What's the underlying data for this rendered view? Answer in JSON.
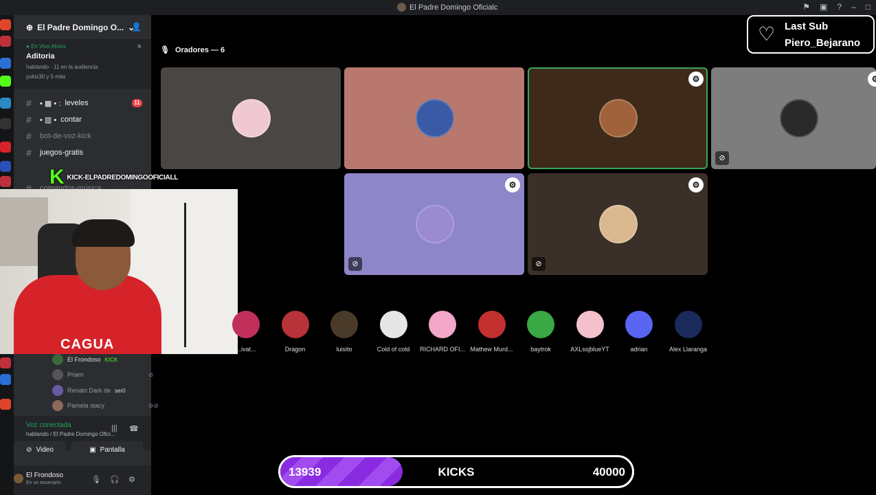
{
  "window": {
    "title": "El Padre Domingo Oficialᴄ"
  },
  "server": {
    "name": "El Padre Domingo O..."
  },
  "live": {
    "status": "En Vivo Ahora",
    "stage_name": "Aditoria",
    "detail": "hablando · 11 en la audiencia",
    "viewers": "yukix30 y 5 más",
    "close": "×"
  },
  "channels": [
    {
      "prefix": "• ▩ • :",
      "name": "leveles",
      "badge": "11"
    },
    {
      "prefix": "• ▥ •",
      "name": "contar"
    },
    {
      "prefix": "",
      "name": "bot-de-voz-kick"
    },
    {
      "prefix": "",
      "name": "juegos-gratis"
    },
    {
      "prefix": "",
      "name": "comandos-música"
    }
  ],
  "kick_banner": "KICK-ELPADREDOMINGOOFICIALL",
  "members": [
    {
      "name": "El Frondoso",
      "tag": "KICK"
    },
    {
      "name": "Priam",
      "tag": ""
    },
    {
      "name": "Renato Dark de",
      "tag": "ser0"
    },
    {
      "name": "Pamela stacy",
      "tag": ""
    }
  ],
  "voice": {
    "status": "Voz conectada",
    "channel": "hablando / El Padre Domingo Ofici...",
    "video_label": "Video",
    "screen_label": "Pantalla"
  },
  "user": {
    "name": "El Frondoso",
    "status": "En un escenario"
  },
  "stage": {
    "speakers_label": "Oradores — 6"
  },
  "last_sub": {
    "label": "Last Sub",
    "name": "Piero_Bejarano"
  },
  "audience": [
    {
      "name": "...ivat...",
      "color": "#c0305a"
    },
    {
      "name": "Dragon",
      "color": "#b8323a"
    },
    {
      "name": "luisito",
      "color": "#4a3a2a"
    },
    {
      "name": "Cold of cold",
      "color": "#e6e6e6"
    },
    {
      "name": "RICHARD OFI...",
      "color": "#f2a6c8"
    },
    {
      "name": "Mathew Murd...",
      "color": "#c23030"
    },
    {
      "name": "baytrok",
      "color": "#3aa845"
    },
    {
      "name": "AXLssjblueYT",
      "color": "#f3c0cc"
    },
    {
      "name": "adrian",
      "color": "#5865f2"
    },
    {
      "name": "Alex Llaranga",
      "color": "#1a2a5a"
    }
  ],
  "kicks_goal": {
    "current": "13939",
    "label": "KICKS",
    "goal": "40000",
    "progress": 0.3485
  },
  "webcam": {
    "shirt_text": "CAGUA"
  },
  "colors": {
    "accent_green": "#23a55a",
    "kick_green": "#53fc18",
    "goal_purple": "#8a2be2"
  }
}
